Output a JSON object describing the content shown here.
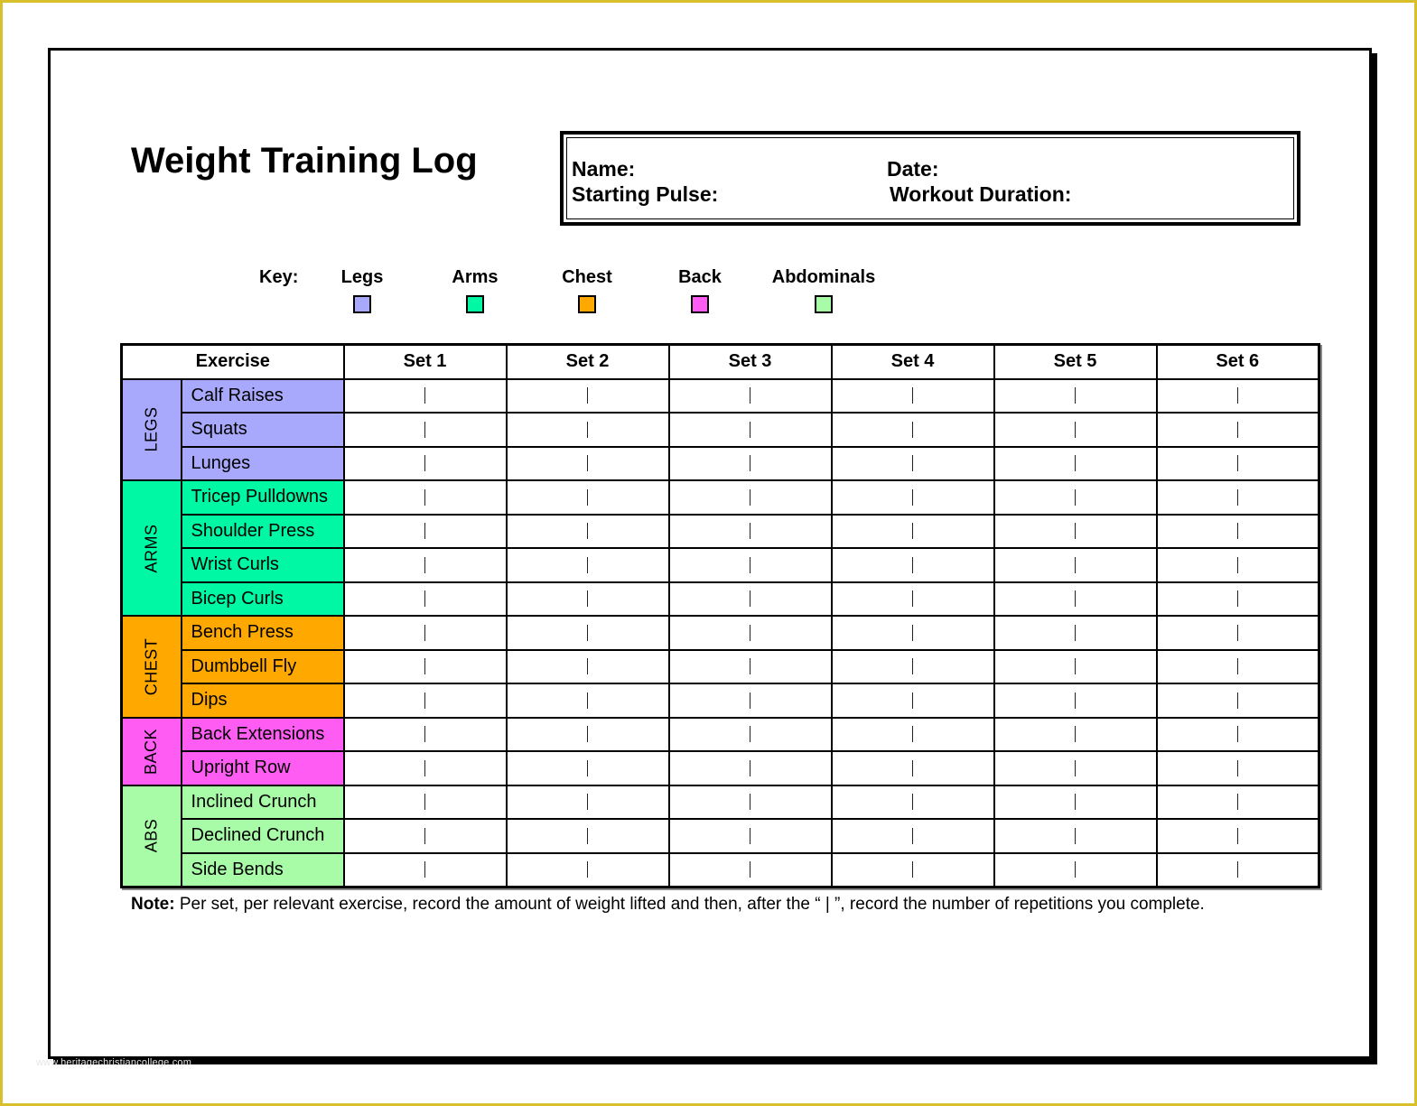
{
  "document": {
    "title": "Weight Training Log",
    "watermark": "www.heritagechristiancollege.com"
  },
  "info_box": {
    "name_label": "Name:",
    "date_label": "Date:",
    "starting_pulse_label": "Starting Pulse:",
    "workout_duration_label": "Workout Duration:"
  },
  "key": {
    "label": "Key:",
    "items": [
      {
        "label": "Legs",
        "color": "#a8a8fc"
      },
      {
        "label": "Arms",
        "color": "#00f7a3"
      },
      {
        "label": "Chest",
        "color": "#ffa800"
      },
      {
        "label": "Back",
        "color": "#ff5cf3"
      },
      {
        "label": "Abdominals",
        "color": "#a8fca8"
      }
    ]
  },
  "table": {
    "header": {
      "exercise": "Exercise",
      "sets": [
        "Set 1",
        "Set 2",
        "Set 3",
        "Set 4",
        "Set 5",
        "Set 6"
      ]
    },
    "separator": "|",
    "groups": [
      {
        "label": "LEGS",
        "color": "#a8a8fc",
        "exercises": [
          "Calf Raises",
          "Squats",
          "Lunges"
        ]
      },
      {
        "label": "ARMS",
        "color": "#00f7a3",
        "exercises": [
          "Tricep Pulldowns",
          "Shoulder Press",
          "Wrist Curls",
          "Bicep Curls"
        ]
      },
      {
        "label": "CHEST",
        "color": "#ffa800",
        "exercises": [
          "Bench Press",
          "Dumbbell Fly",
          "Dips"
        ]
      },
      {
        "label": "BACK",
        "color": "#ff5cf3",
        "exercises": [
          "Back Extensions",
          "Upright Row"
        ]
      },
      {
        "label": "ABS",
        "color": "#a8fca8",
        "exercises": [
          "Inclined Crunch",
          "Declined Crunch",
          "Side Bends"
        ]
      }
    ]
  },
  "note": {
    "label": "Note:",
    "text": " Per set, per relevant exercise, record the amount of weight lifted and then, after the “ | ”, record the number of repetitions you complete."
  }
}
